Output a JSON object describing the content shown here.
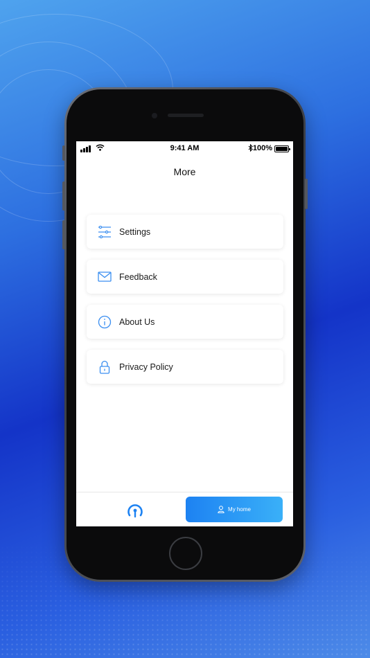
{
  "status_bar": {
    "time": "9:41 AM",
    "battery_percent": "100%",
    "battery_level": 1.0
  },
  "page": {
    "title": "More"
  },
  "menu": {
    "items": [
      {
        "label": "Settings",
        "icon": "sliders-icon"
      },
      {
        "label": "Feedback",
        "icon": "mail-icon"
      },
      {
        "label": "About Us",
        "icon": "info-icon"
      },
      {
        "label": "Privacy Policy",
        "icon": "lock-icon"
      }
    ]
  },
  "tab_bar": {
    "connect_icon": "connect-icon",
    "home_label": "My home",
    "home_icon": "user-icon"
  },
  "colors": {
    "accent": "#1d82f2",
    "accent_light": "#3ab0f8",
    "icon_blue": "#3a8ef0"
  }
}
